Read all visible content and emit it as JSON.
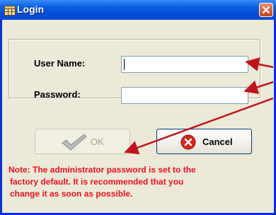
{
  "window": {
    "title": "Login"
  },
  "form": {
    "username_label": "User Name:",
    "username_value": "",
    "password_label": "Password:",
    "password_value": ""
  },
  "buttons": {
    "ok_label": "OK",
    "cancel_label": "Cancel"
  },
  "note": {
    "line1": "Note: The administrator password is set to the",
    "line2": "factory default. It  is recommended that  you",
    "line3": "change it as soon as possible."
  },
  "colors": {
    "title_bar": "#0249d4",
    "note_text": "#e8101e",
    "annotation_arrows": "#c0141c",
    "window_bg": "#ece9d8"
  },
  "icons": {
    "app": "grid-app-icon",
    "close": "close-x-icon",
    "ok": "checkmark-icon",
    "cancel": "red-x-circle-icon"
  }
}
